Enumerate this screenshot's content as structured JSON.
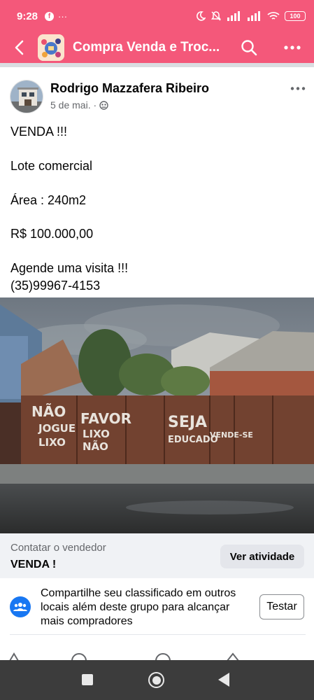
{
  "status_bar": {
    "time": "9:28",
    "extra_icons": "···",
    "battery": "100"
  },
  "app_bar": {
    "title": "Compra Venda e Troc..."
  },
  "post": {
    "author": "Rodrigo Mazzafera Ribeiro",
    "date": "5 de mai. ·",
    "text_lines": [
      "VENDA !!!",
      "",
      "Lote comercial",
      "",
      "Área : 240m2",
      "",
      "R$ 100.000,00",
      "",
      "Agende uma visita !!!",
      "(35)99967-4153"
    ]
  },
  "photo": {
    "graffiti": [
      "NÃO",
      "JOGUE",
      "LIXO",
      "FAVOR",
      "LIXO",
      "NÃO",
      "SEJA",
      "EDUCADO",
      "VENDE-SE"
    ]
  },
  "listing": {
    "contact_label": "Contatar o vendedor",
    "title": "VENDA !",
    "activity_button": "Ver atividade"
  },
  "share_prompt": {
    "text": "Compartilhe seu classificado em outros locais além deste grupo para alcançar mais compradores",
    "button": "Testar"
  },
  "colors": {
    "brand_bar": "#f4587a",
    "link_blue": "#1877f2"
  },
  "icons": [
    "facebook-icon",
    "moon-icon",
    "bell-off-icon",
    "signal-icon",
    "wifi-icon",
    "battery-icon",
    "back-arrow-icon",
    "search-icon",
    "more-icon",
    "globe-group-icon",
    "group-share-icon"
  ]
}
